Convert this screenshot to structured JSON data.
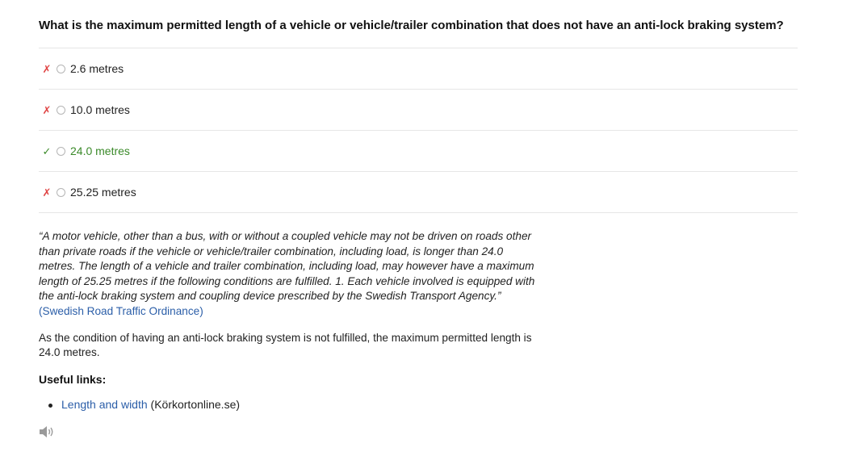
{
  "question": "What is the maximum permitted length of a vehicle or vehicle/trailer combination that does not have an anti-lock braking system?",
  "answers": [
    {
      "mark": "✗",
      "label": "2.6 metres",
      "status": "wrong"
    },
    {
      "mark": "✗",
      "label": "10.0 metres",
      "status": "wrong"
    },
    {
      "mark": "✓",
      "label": "24.0 metres",
      "status": "correct"
    },
    {
      "mark": "✗",
      "label": "25.25 metres",
      "status": "wrong"
    }
  ],
  "explanation": {
    "quote": "“A motor vehicle, other than a bus, with or without a coupled vehicle may not be driven on roads other than private roads if the vehicle or vehicle/trailer combination, including load, is longer than 24.0 metres. The length of a vehicle and trailer combination, including load, may however have a maximum length of 25.25 metres if the following conditions are fulfilled. 1. Each vehicle involved is equipped with the anti-lock braking system and coupling device prescribed by the Swedish Transport Agency.”",
    "source_link": "(Swedish Road Traffic Ordinance)",
    "paragraph": "As the condition of having an anti-lock braking system is not fulfilled, the maximum permitted length is 24.0 metres."
  },
  "useful_links": {
    "title": "Useful links:",
    "items": [
      {
        "link_text": "Length and width",
        "source": "(Körkortonline.se)"
      }
    ]
  },
  "icons": {
    "speaker": "speaker-icon",
    "wrong": "cross-icon",
    "correct": "check-icon"
  },
  "colors": {
    "wrong": "#e04646",
    "correct": "#3b8a2a",
    "link": "#2b5ea8"
  }
}
